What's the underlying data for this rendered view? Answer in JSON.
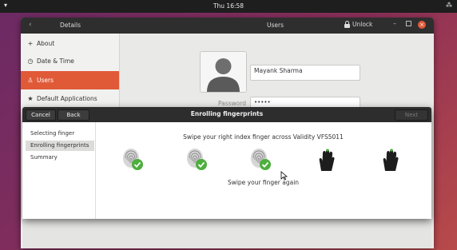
{
  "topbar": {
    "clock": "Thu 16:58"
  },
  "settings": {
    "back_glyph": "‹",
    "panel_title": "Details",
    "page_title": "Users",
    "unlock_label": "Unlock",
    "sidebar": [
      {
        "icon": "plus-icon",
        "glyph": "+",
        "label": "About"
      },
      {
        "icon": "clock-icon",
        "glyph": "◷",
        "label": "Date & Time"
      },
      {
        "icon": "user-icon",
        "glyph": "♙",
        "label": "Users"
      },
      {
        "icon": "star-icon",
        "glyph": "★",
        "label": "Default Applications"
      }
    ],
    "user": {
      "name": "Mayank Sharma",
      "password_label": "Password",
      "password_value": "•••••"
    }
  },
  "dialog": {
    "cancel_label": "Cancel",
    "back_label": "Back",
    "title": "Enrolling fingerprints",
    "next_label": "Next",
    "steps": [
      "Selecting finger",
      "Enrolling fingerprints",
      "Summary"
    ],
    "instruction": "Swipe your right index finger across Validity VFS5011",
    "status": "Swipe your finger again",
    "fingerprints": [
      {
        "state": "done",
        "icon": "fingerprint-done-icon"
      },
      {
        "state": "done",
        "icon": "fingerprint-done-icon"
      },
      {
        "state": "done",
        "icon": "fingerprint-done-icon"
      },
      {
        "state": "pending",
        "icon": "swipe-hand-icon"
      },
      {
        "state": "pending",
        "icon": "swipe-hand-icon"
      }
    ],
    "colors": {
      "accent": "#e05a38",
      "check": "#4caf3d",
      "header": "#2d2d2d"
    }
  }
}
